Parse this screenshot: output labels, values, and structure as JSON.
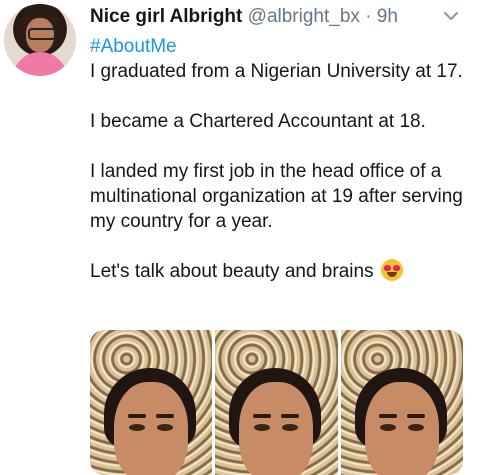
{
  "author": {
    "name": "Nice girl Albright",
    "handle": "@albright_bx",
    "separator": "·",
    "time": "9h"
  },
  "tweet": {
    "hashtag": "#AboutMe",
    "paragraphs": [
      "I graduated from a Nigerian University at 17.",
      "I became a Chartered Accountant at 18.",
      "I landed my first job in the head office of a multinational organization at 19 after serving my country for a year.",
      "Let's talk about beauty and brains"
    ],
    "emoji": "heart-eyes-emoji"
  },
  "media": {
    "photo_count": 3
  },
  "icons": {
    "menu": "chevron-down-icon"
  },
  "colors": {
    "link": "#1b95e0",
    "muted": "#657786",
    "text": "#14171a"
  }
}
